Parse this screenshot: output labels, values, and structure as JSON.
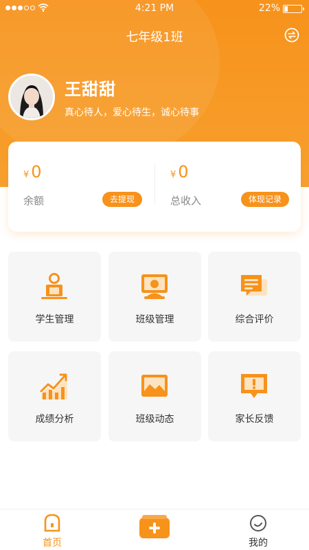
{
  "status_bar": {
    "time": "4:21 PM",
    "battery": "22%",
    "battery_level": 0.22
  },
  "nav": {
    "title": "七年级1班"
  },
  "profile": {
    "name": "王甜甜",
    "motto": "真心待人，爱心待生，诚心待事"
  },
  "wallet": {
    "currency_symbol": "¥",
    "balance": {
      "value": "0",
      "label": "余额",
      "button": "去提现"
    },
    "income": {
      "value": "0",
      "label": "总收入",
      "button": "体现记录"
    }
  },
  "menu": [
    {
      "label": "学生管理",
      "icon": "student-reading-icon"
    },
    {
      "label": "班级管理",
      "icon": "class-monitor-icon"
    },
    {
      "label": "综合评价",
      "icon": "evaluation-chat-icon"
    },
    {
      "label": "成绩分析",
      "icon": "grade-chart-icon"
    },
    {
      "label": "班级动态",
      "icon": "class-photo-icon"
    },
    {
      "label": "家长反馈",
      "icon": "feedback-alert-icon"
    }
  ],
  "tab_bar": {
    "home": "首页",
    "mine": "我的"
  },
  "colors": {
    "accent": "#f7921b",
    "tile_bg": "#f6f6f6"
  }
}
